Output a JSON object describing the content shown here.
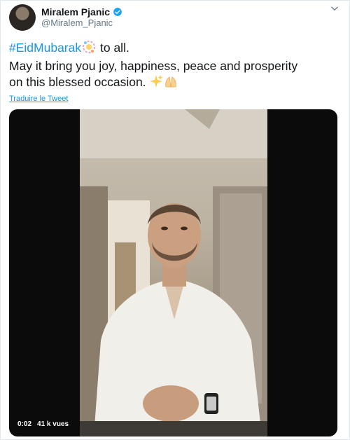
{
  "user": {
    "display_name": "Miralem Pjanic",
    "handle": "@Miralem_Pjanic",
    "verified": true
  },
  "tweet": {
    "hashtag": "#EidMubarak",
    "line1_rest": " to all.",
    "line2": "May it bring you joy, happiness, peace and prosperity",
    "line3": "on this blessed occasion.",
    "emojis": [
      "balloon-emoji",
      "sparkles-emoji",
      "praying-hands-emoji"
    ]
  },
  "translate_label": "Traduire le Tweet",
  "video": {
    "time": "0:02",
    "views": "41 k vues"
  },
  "colors": {
    "link": "#1b95e0",
    "verified": "#1da1f2",
    "handle": "#657786"
  }
}
